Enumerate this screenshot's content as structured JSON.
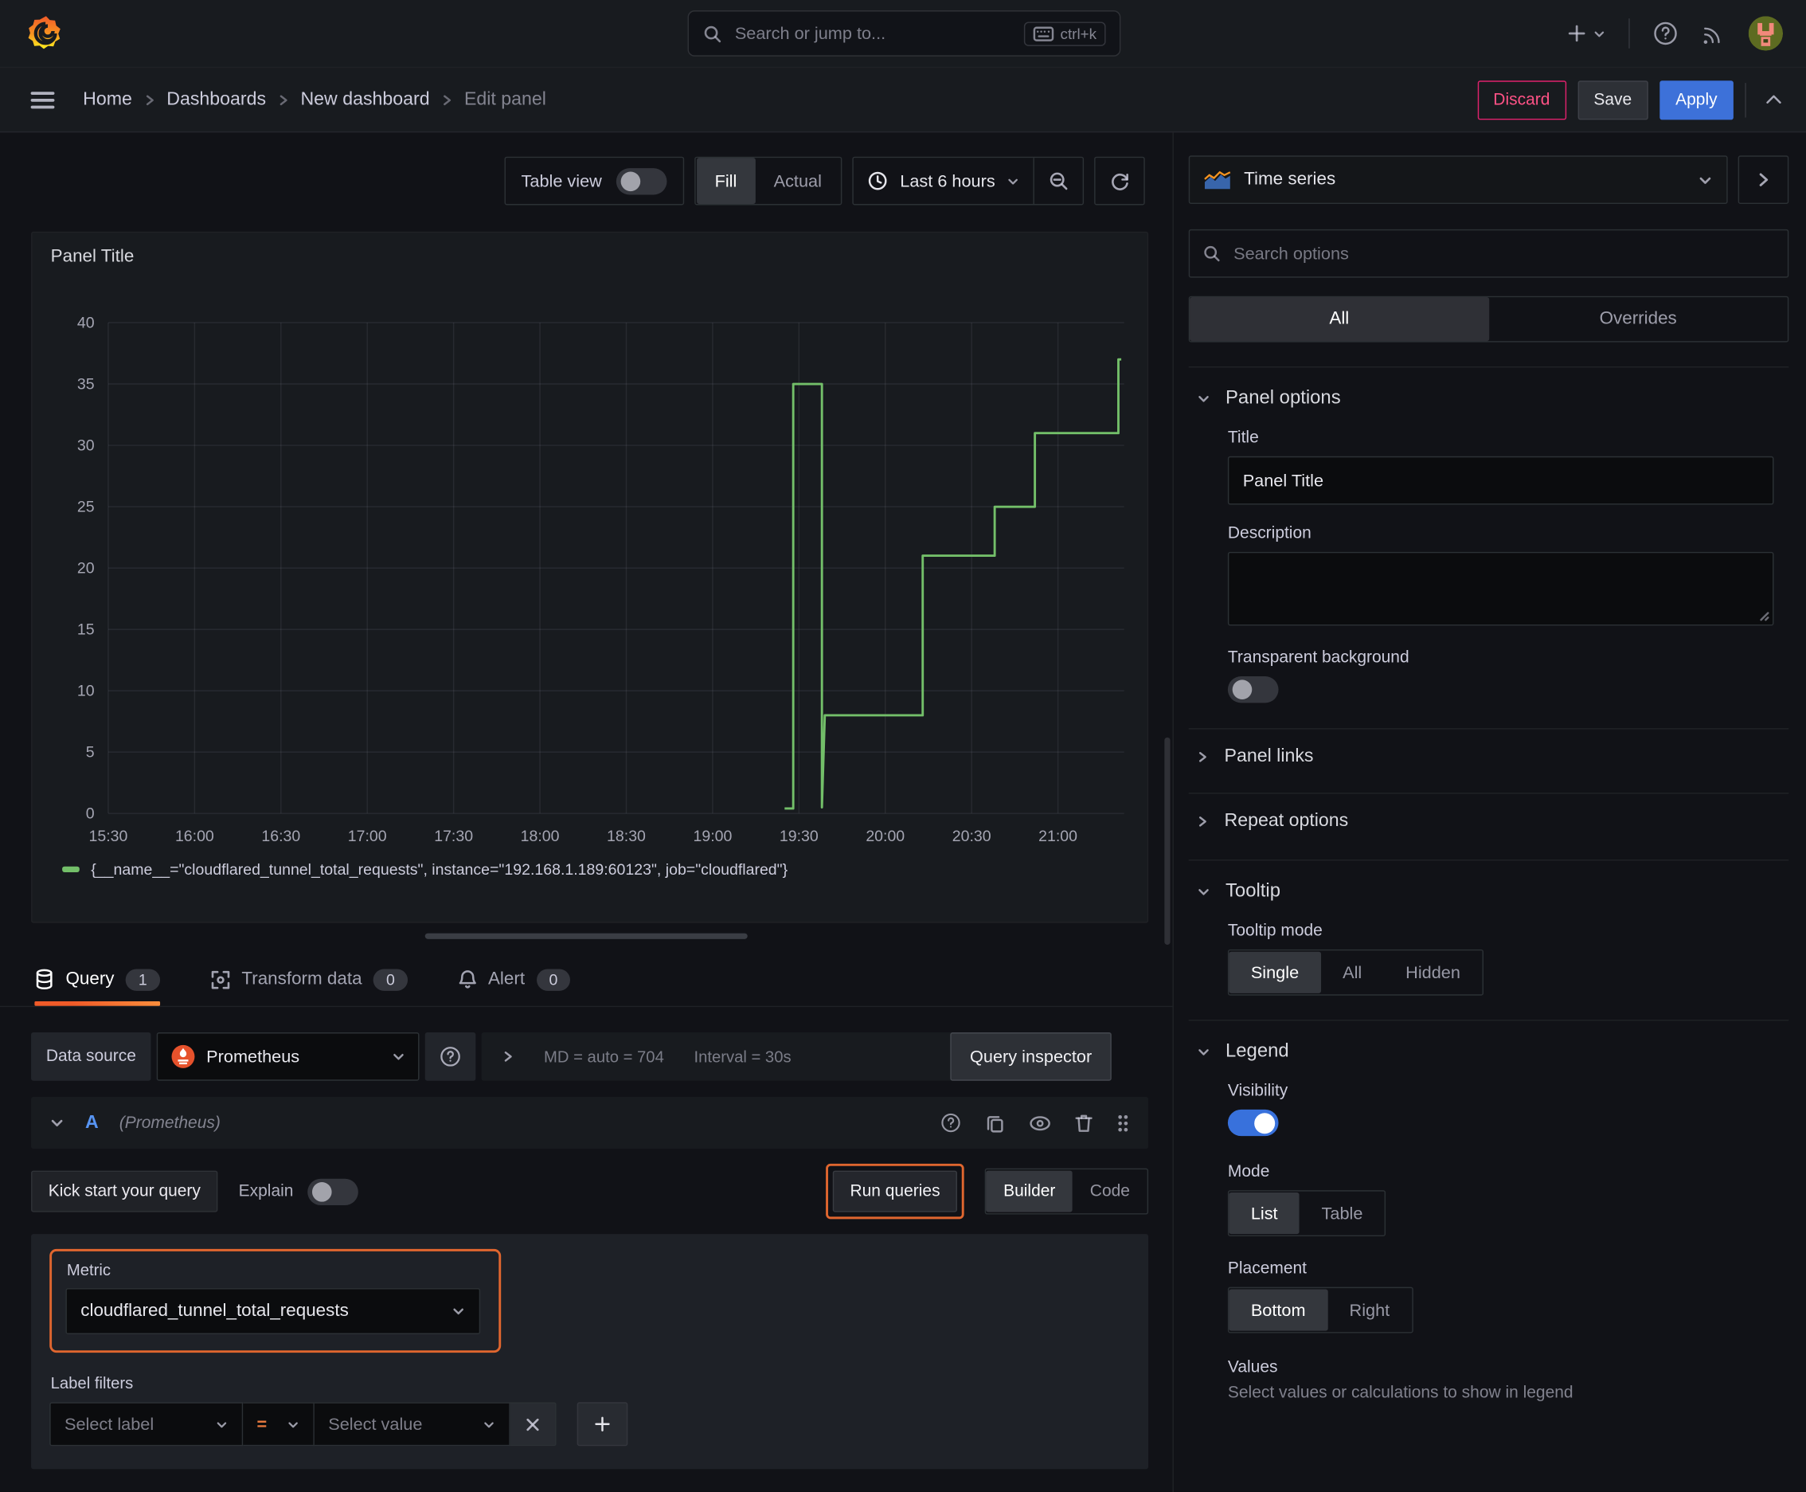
{
  "topbar": {
    "search_placeholder": "Search or jump to...",
    "shortcut": "ctrl+k"
  },
  "breadcrumb": {
    "items": [
      "Home",
      "Dashboards",
      "New dashboard",
      "Edit panel"
    ],
    "discard": "Discard",
    "save": "Save",
    "apply": "Apply"
  },
  "toolbar": {
    "table_view": "Table view",
    "fill": "Fill",
    "actual": "Actual",
    "time_range": "Last 6 hours"
  },
  "panel": {
    "title": "Panel Title"
  },
  "chart_data": {
    "type": "line",
    "step": true,
    "title": "Panel Title",
    "x_ticks": [
      "15:30",
      "16:00",
      "16:30",
      "17:00",
      "17:30",
      "18:00",
      "18:30",
      "19:00",
      "19:30",
      "20:00",
      "20:30",
      "21:00"
    ],
    "y_ticks": [
      0,
      5,
      10,
      15,
      20,
      25,
      30,
      35,
      40
    ],
    "ylim": [
      0,
      40
    ],
    "xlim": [
      "15:30",
      "21:23"
    ],
    "grid": true,
    "legend_position": "bottom",
    "series": [
      {
        "name": "{__name__=\"cloudflared_tunnel_total_requests\", instance=\"192.168.1.189:60123\", job=\"cloudflared\"}",
        "color": "#73bf69",
        "points": [
          [
            "19:25",
            0.4
          ],
          [
            "19:28",
            0.4
          ],
          [
            "19:28",
            35
          ],
          [
            "19:38",
            35
          ],
          [
            "19:38",
            0.5
          ],
          [
            "19:39",
            8
          ],
          [
            "20:13",
            8
          ],
          [
            "20:13",
            21
          ],
          [
            "20:38",
            21
          ],
          [
            "20:38",
            25
          ],
          [
            "20:52",
            25
          ],
          [
            "20:52",
            31
          ],
          [
            "21:21",
            31
          ],
          [
            "21:21",
            37
          ],
          [
            "21:22",
            37
          ]
        ]
      }
    ]
  },
  "tabs": {
    "query": "Query",
    "query_count": "1",
    "transform": "Transform data",
    "transform_count": "0",
    "alert": "Alert",
    "alert_count": "0"
  },
  "datasource": {
    "label": "Data source",
    "name": "Prometheus",
    "maxdata": "MD = auto = 704",
    "interval": "Interval = 30s",
    "inspector": "Query inspector"
  },
  "query": {
    "ref": "A",
    "ds": "(Prometheus)",
    "kickstart": "Kick start your query",
    "explain": "Explain",
    "run": "Run queries",
    "builder": "Builder",
    "code": "Code",
    "metric_label": "Metric",
    "metric_value": "cloudflared_tunnel_total_requests",
    "label_filters": "Label filters",
    "select_label": "Select label",
    "operator": "=",
    "select_value": "Select value"
  },
  "viz": {
    "name": "Time series"
  },
  "options": {
    "search_placeholder": "Search options",
    "tab_all": "All",
    "tab_overrides": "Overrides",
    "panel_options": "Panel options",
    "title_label": "Title",
    "title_value": "Panel Title",
    "description": "Description",
    "transparent": "Transparent background",
    "panel_links": "Panel links",
    "repeat_options": "Repeat options",
    "tooltip": "Tooltip",
    "tooltip_mode": "Tooltip mode",
    "single": "Single",
    "all": "All",
    "hidden": "Hidden",
    "legend": "Legend",
    "visibility": "Visibility",
    "mode": "Mode",
    "list": "List",
    "table": "Table",
    "placement": "Placement",
    "bottom": "Bottom",
    "right": "Right",
    "values": "Values",
    "values_hint": "Select values or calculations to show in legend"
  },
  "colors": {
    "accent_blue": "#3d71d9",
    "highlight_orange": "#e0662f",
    "series_green": "#73bf69",
    "discard_pink": "#ff5286",
    "tab_underline": "#f05a28"
  }
}
